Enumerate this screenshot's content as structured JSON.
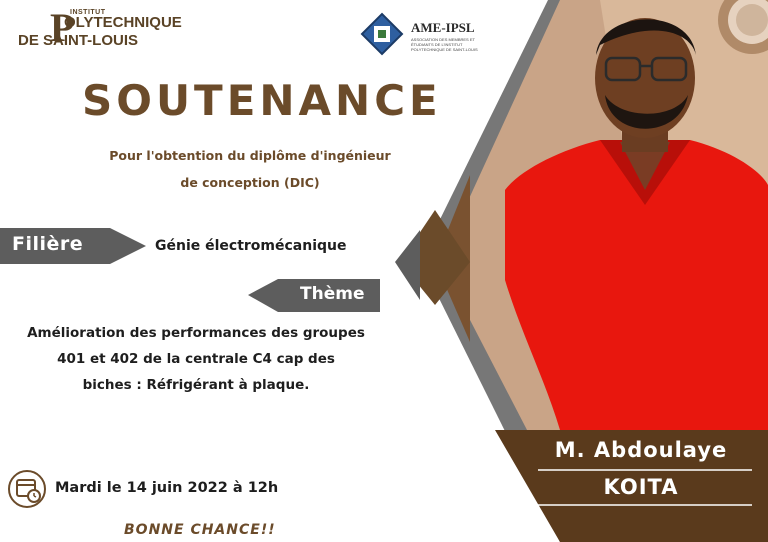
{
  "logos": {
    "ip_institut": "INSTITUT",
    "ip_line1": "OLYTECHNIQUE",
    "ip_p": "P",
    "ip_line2": "DE SAINT-LOUIS",
    "ame_name": "AME-IPSL",
    "ame_sub": "ASSOCIATION DES MEMBRES ET ÉTUDIANTS DE L'INSTITUT POLYTECHNIQUE DE SAINT-LOUIS"
  },
  "title": "SOUTENANCE",
  "subtitle_line1": "Pour l'obtention du diplôme d'ingénieur",
  "subtitle_line2": "de conception (DIC)",
  "filiere": {
    "label": "Filière",
    "value": "Génie électromécanique"
  },
  "theme": {
    "label": "Thème",
    "line1": "Amélioration des performances des groupes",
    "line2": "401 et 402 de la centrale C4 cap des",
    "line3": "biches : Réfrigérant à plaque."
  },
  "date": "Mardi le 14 juin 2022 à 12h",
  "closing": "BONNE CHANCE!!",
  "person": {
    "line1": "M. Abdoulaye",
    "line2": "KOITA"
  },
  "colors": {
    "brown": "#6b4b2a",
    "grey_tag": "#5d5d5d",
    "shirt_red": "#e8170e",
    "name_box": "#5a3a1c"
  }
}
